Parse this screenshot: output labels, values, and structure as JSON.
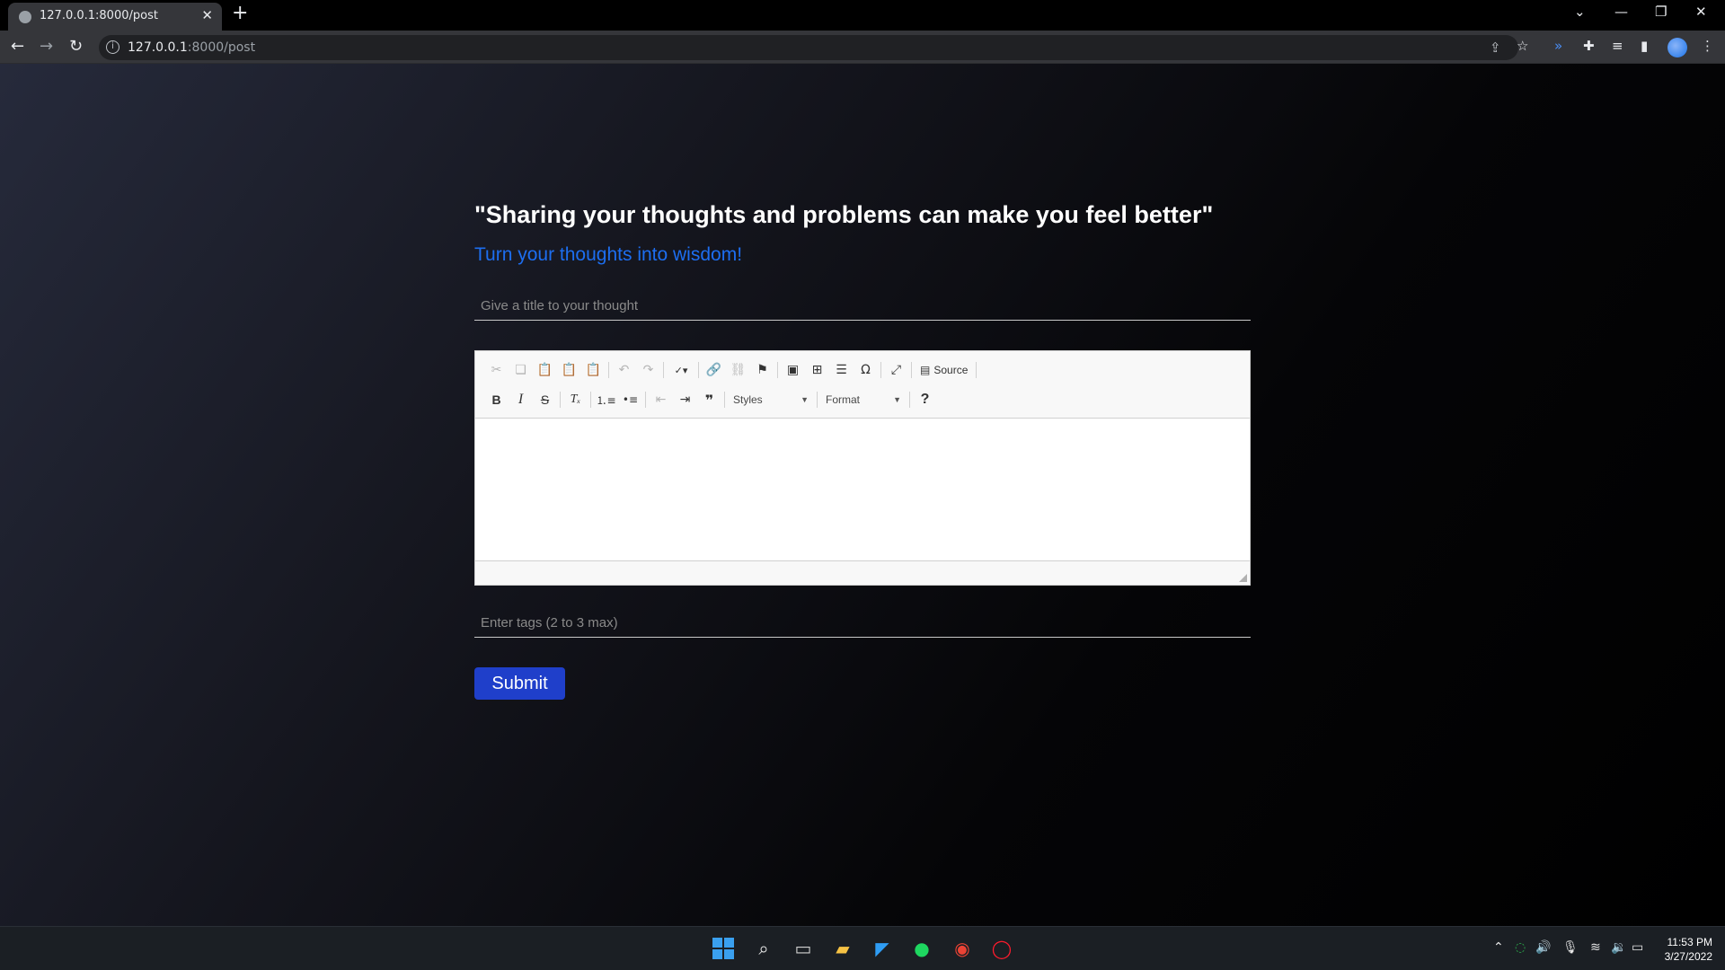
{
  "browser": {
    "tab_title": "127.0.0.1:8000/post",
    "url_host": "127.0.0.1",
    "url_path": ":8000/post"
  },
  "page": {
    "quote": "\"Sharing your thoughts and problems can make you feel better\"",
    "subtitle": "Turn your thoughts into wisdom!",
    "title_input": {
      "placeholder": "Give a title to your thought",
      "value": ""
    },
    "tags_input": {
      "placeholder": "Enter tags (2 to 3 max)",
      "value": ""
    },
    "submit_label": "Submit"
  },
  "editor": {
    "source_label": "Source",
    "styles_label": "Styles",
    "format_label": "Format",
    "help_label": "?"
  },
  "taskbar": {
    "time": "11:53 PM",
    "date": "3/27/2022"
  },
  "colors": {
    "accent_blue": "#1d6ef0",
    "submit_bg": "#1f3fca",
    "page_bg": "#000000"
  }
}
